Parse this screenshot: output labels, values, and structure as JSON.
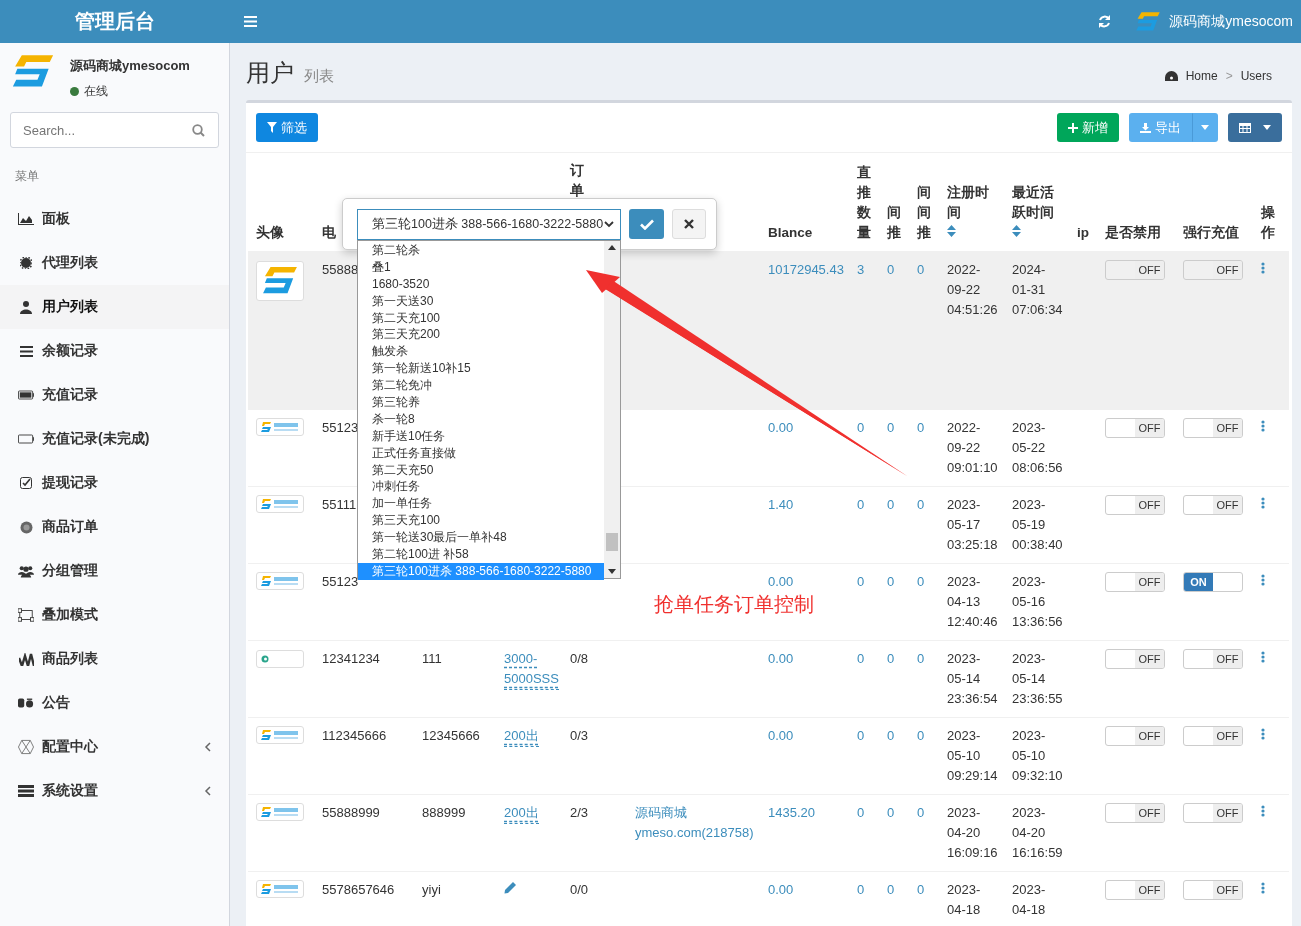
{
  "topbar": {
    "brand": "管理后台",
    "user": "源码商城ymesocom"
  },
  "sidebar": {
    "user": {
      "name": "源码商城ymesocom",
      "status": "在线"
    },
    "search": {
      "placeholder": "Search..."
    },
    "menu_header": "菜单",
    "items": [
      {
        "label": "面板",
        "selected": false,
        "expandable": false
      },
      {
        "label": "代理列表",
        "selected": false,
        "expandable": false
      },
      {
        "label": "用户列表",
        "selected": true,
        "expandable": false
      },
      {
        "label": "余额记录",
        "selected": false,
        "expandable": false
      },
      {
        "label": "充值记录",
        "selected": false,
        "expandable": false
      },
      {
        "label": "充值记录(未完成)",
        "selected": false,
        "expandable": false
      },
      {
        "label": "提现记录",
        "selected": false,
        "expandable": false
      },
      {
        "label": "商品订单",
        "selected": false,
        "expandable": false
      },
      {
        "label": "分组管理",
        "selected": false,
        "expandable": false
      },
      {
        "label": "叠加模式",
        "selected": false,
        "expandable": false
      },
      {
        "label": "商品列表",
        "selected": false,
        "expandable": false
      },
      {
        "label": "公告",
        "selected": false,
        "expandable": false
      },
      {
        "label": "配置中心",
        "selected": false,
        "expandable": true
      },
      {
        "label": "系统设置",
        "selected": false,
        "expandable": true
      }
    ]
  },
  "page": {
    "title": "用户",
    "subtitle": "列表",
    "breadcrumb": [
      "Home",
      "Users"
    ],
    "breadcrumb_separator": ">"
  },
  "toolbar": {
    "filter": "筛选",
    "add": "新增",
    "export": "导出"
  },
  "table": {
    "columns": [
      {
        "label": "头像"
      },
      {
        "label": "电"
      },
      null,
      null,
      {
        "label": "订单"
      },
      null,
      {
        "label": "Blance"
      },
      {
        "label": "直推数量"
      },
      {
        "label": "间推"
      },
      {
        "label": "间间推"
      },
      {
        "label": "注册时间",
        "sortable": true
      },
      {
        "label": "最近活跃时间",
        "sortable": true
      },
      {
        "label": "ip"
      },
      {
        "label": "是否禁用"
      },
      {
        "label": "强行充值"
      },
      {
        "label": "操作"
      }
    ],
    "rows": [
      {
        "avatar": {
          "kind": "large"
        },
        "highlighted": true,
        "phone": "55888",
        "balance": "10172945.43",
        "direct": "3",
        "indirect": "0",
        "indirect2": "0",
        "registered": "2022-09-22 04:51:26",
        "active": "2024-01-31 07:06:34",
        "banned": {
          "on": false,
          "label": "OFF"
        },
        "force_recharge": {
          "on": false,
          "label": "OFF"
        }
      },
      {
        "avatar": {
          "kind": "small"
        },
        "highlighted": false,
        "phone": "55123",
        "balance": "0.00",
        "direct": "0",
        "indirect": "0",
        "indirect2": "0",
        "registered": "2022-09-22 09:01:10",
        "active": "2023-05-22 08:06:56",
        "banned": {
          "on": false,
          "label": "OFF"
        },
        "force_recharge": {
          "on": false,
          "label": "OFF"
        }
      },
      {
        "avatar": {
          "kind": "small"
        },
        "highlighted": false,
        "phone": "55111",
        "balance": "1.40",
        "direct": "0",
        "indirect": "0",
        "indirect2": "0",
        "registered": "2023-05-17 03:25:18",
        "active": "2023-05-19 00:38:40",
        "banned": {
          "on": false,
          "label": "OFF"
        },
        "force_recharge": {
          "on": false,
          "label": "OFF"
        }
      },
      {
        "avatar": {
          "kind": "small"
        },
        "highlighted": false,
        "phone": "55123",
        "balance": "0.00",
        "direct": "0",
        "indirect": "0",
        "indirect2": "0",
        "registered": "2023-04-13 12:40:46",
        "active": "2023-05-16 13:36:56",
        "banned": {
          "on": false,
          "label": "OFF"
        },
        "force_recharge": {
          "on": true,
          "label": "ON"
        }
      },
      {
        "avatar": {
          "kind": "tiny"
        },
        "highlighted": false,
        "phone": "12341234",
        "username": "111",
        "group": {
          "kind": "link",
          "text": "3000-5000SSS"
        },
        "orders": "0/8",
        "balance": "0.00",
        "direct": "0",
        "indirect": "0",
        "indirect2": "0",
        "registered": "2023-05-14 23:36:54",
        "active": "2023-05-14 23:36:55",
        "banned": {
          "on": false,
          "label": "OFF"
        },
        "force_recharge": {
          "on": false,
          "label": "OFF"
        }
      },
      {
        "avatar": {
          "kind": "small"
        },
        "highlighted": false,
        "phone": "112345666",
        "username": "12345666",
        "group": {
          "kind": "link",
          "text": "200出"
        },
        "orders": "0/3",
        "balance": "0.00",
        "direct": "0",
        "indirect": "0",
        "indirect2": "0",
        "registered": "2023-05-10 09:29:14",
        "active": "2023-05-10 09:32:10",
        "banned": {
          "on": false,
          "label": "OFF"
        },
        "force_recharge": {
          "on": false,
          "label": "OFF"
        }
      },
      {
        "avatar": {
          "kind": "small"
        },
        "highlighted": false,
        "phone": "55888999",
        "username": "888999",
        "group": {
          "kind": "link",
          "text": "200出"
        },
        "orders": "2/3",
        "referrer": "源码商城 ymeso.com(218758)",
        "balance": "1435.20",
        "direct": "0",
        "indirect": "0",
        "indirect2": "0",
        "registered": "2023-04-20 16:09:16",
        "active": "2023-04-20 16:16:59",
        "banned": {
          "on": false,
          "label": "OFF"
        },
        "force_recharge": {
          "on": false,
          "label": "OFF"
        }
      },
      {
        "avatar": {
          "kind": "small"
        },
        "highlighted": false,
        "phone": "5578657646",
        "username": "yiyi",
        "group": {
          "kind": "edit"
        },
        "orders": "0/0",
        "balance": "0.00",
        "direct": "0",
        "indirect": "0",
        "indirect2": "0",
        "registered": "2023-04-18",
        "active": "2023-04-18",
        "banned": {
          "on": false,
          "label": "OFF"
        },
        "force_recharge": {
          "on": false,
          "label": "OFF"
        }
      }
    ]
  },
  "popup": {
    "value": "第三轮100进杀 388-566-1680-3222-5880",
    "options": [
      {
        "label": "第二轮杀",
        "selected": false
      },
      {
        "label": "叠1",
        "selected": false
      },
      {
        "label": "1680-3520",
        "selected": false
      },
      {
        "label": "第一天送30",
        "selected": false
      },
      {
        "label": "第二天充100",
        "selected": false
      },
      {
        "label": "第三天充200",
        "selected": false
      },
      {
        "label": "触发杀",
        "selected": false
      },
      {
        "label": "第一轮新送10补15",
        "selected": false
      },
      {
        "label": "第二轮免冲",
        "selected": false
      },
      {
        "label": "第三轮养",
        "selected": false
      },
      {
        "label": "杀一轮8",
        "selected": false
      },
      {
        "label": "新手送10任务",
        "selected": false
      },
      {
        "label": "正式任务直接做",
        "selected": false
      },
      {
        "label": "第二天充50",
        "selected": false
      },
      {
        "label": "冲刺任务",
        "selected": false
      },
      {
        "label": "加一单任务",
        "selected": false
      },
      {
        "label": "第三天充100",
        "selected": false
      },
      {
        "label": "第一轮送30最后一单补48",
        "selected": false
      },
      {
        "label": "第二轮100进 补58",
        "selected": false
      },
      {
        "label": "第三轮100进杀 388-566-1680-3222-5880",
        "selected": true
      }
    ]
  },
  "annotation": {
    "text": "抢单任务订单控制"
  }
}
